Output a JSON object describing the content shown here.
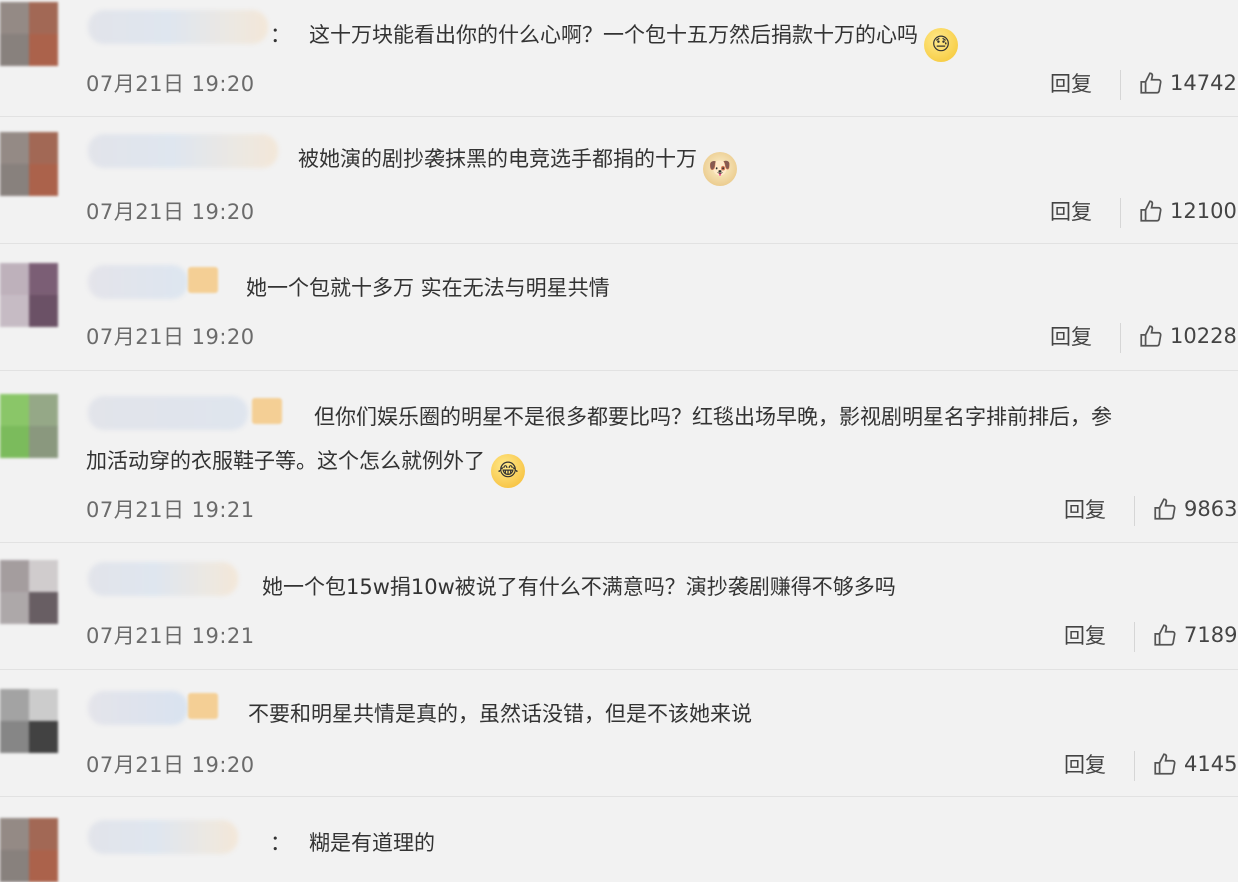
{
  "comments": [
    {
      "colon": "：",
      "text": "这十万块能看出你的什么心啊？一个包十五万然后捐款十万的心吗",
      "emoji": "sweat-emoji",
      "time": "07月21日 19:20",
      "reply": "回复",
      "likes": "14742"
    },
    {
      "colon": "",
      "text": "被她演的剧抄袭抹黑的电竞选手都捐的十万",
      "emoji": "doge-emoji",
      "time": "07月21日 19:20",
      "reply": "回复",
      "likes": "12100"
    },
    {
      "colon": "",
      "text": "她一个包就十多万 实在无法与明星共情",
      "emoji": "",
      "time": "07月21日 19:20",
      "reply": "回复",
      "likes": "10228"
    },
    {
      "colon": "",
      "text": "但你们娱乐圈的明星不是很多都要比吗？红毯出场早晚，影视剧明星名字排前排后，参",
      "text2": "加活动穿的衣服鞋子等。这个怎么就例外了",
      "emoji": "laugh-emoji",
      "time": "07月21日 19:21",
      "reply": "回复",
      "likes": "9863"
    },
    {
      "colon": "",
      "text": "她一个包15w捐10w被说了有什么不满意吗？演抄袭剧赚得不够多吗",
      "emoji": "",
      "time": "07月21日 19:21",
      "reply": "回复",
      "likes": "7189"
    },
    {
      "colon": "",
      "text": "不要和明星共情是真的，虽然话没错，但是不该她来说",
      "emoji": "",
      "time": "07月21日 19:20",
      "reply": "回复",
      "likes": "4145"
    },
    {
      "colon": "：",
      "text": "糊是有道理的",
      "emoji": "",
      "time": "",
      "reply": "",
      "likes": ""
    }
  ],
  "colors": {
    "background": "#f2f2f2",
    "text": "#333333",
    "meta": "#6b6b6b",
    "badge": "#f4cf95"
  },
  "icons": {
    "like": "thumbs-up-icon"
  }
}
